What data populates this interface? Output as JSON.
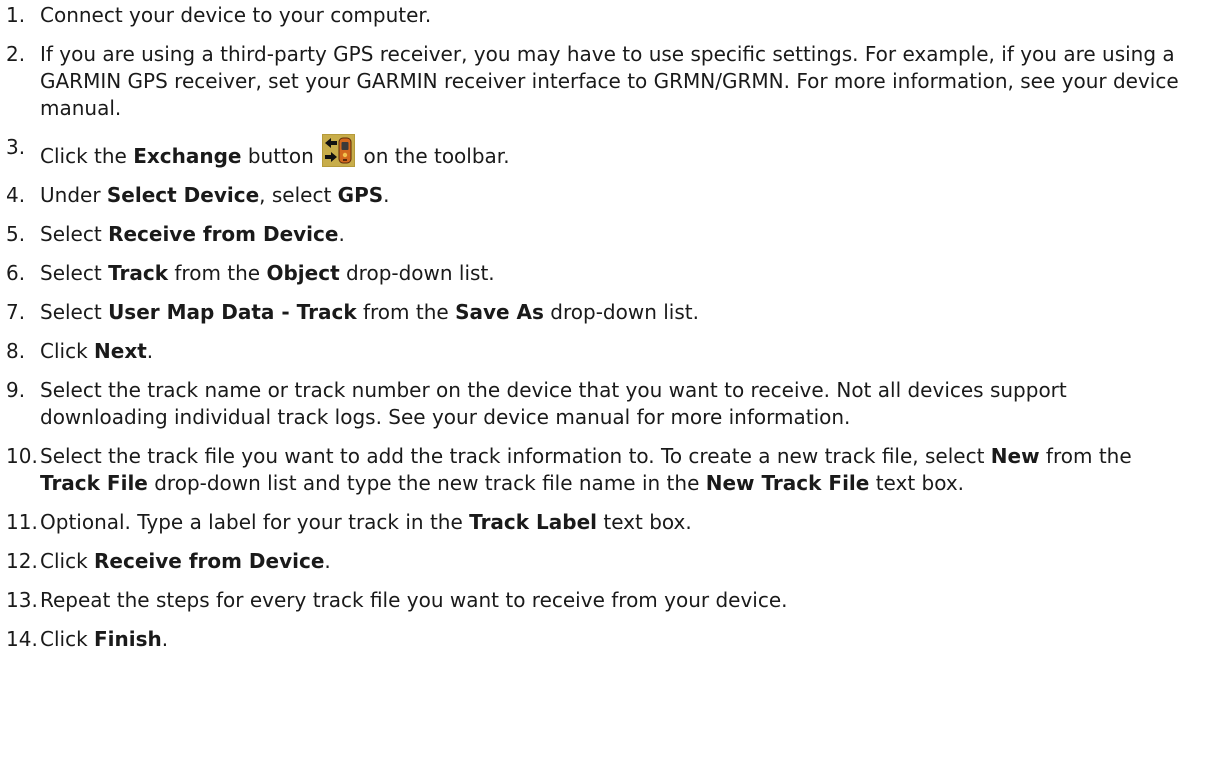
{
  "steps": [
    {
      "num": "1.",
      "segments": [
        {
          "text": "Connect your device to your computer."
        }
      ]
    },
    {
      "num": "2.",
      "segments": [
        {
          "text": "If you are using a third-party GPS receiver, you may have to use specific settings. For example, if you are using a GARMIN GPS receiver, set your GARMIN receiver interface to GRMN/GRMN. For more information, see your device manual."
        }
      ]
    },
    {
      "num": "3.",
      "segments": [
        {
          "text": "Click the "
        },
        {
          "text": "Exchange",
          "bold": true
        },
        {
          "text": " button "
        },
        {
          "icon": "exchange-icon"
        },
        {
          "text": " on the toolbar."
        }
      ]
    },
    {
      "num": "4.",
      "segments": [
        {
          "text": "Under "
        },
        {
          "text": "Select Device",
          "bold": true
        },
        {
          "text": ", select "
        },
        {
          "text": "GPS",
          "bold": true
        },
        {
          "text": "."
        }
      ]
    },
    {
      "num": "5.",
      "segments": [
        {
          "text": "Select "
        },
        {
          "text": "Receive from Device",
          "bold": true
        },
        {
          "text": "."
        }
      ]
    },
    {
      "num": "6.",
      "segments": [
        {
          "text": "Select "
        },
        {
          "text": "Track",
          "bold": true
        },
        {
          "text": " from the "
        },
        {
          "text": "Object",
          "bold": true
        },
        {
          "text": " drop-down list."
        }
      ]
    },
    {
      "num": "7.",
      "segments": [
        {
          "text": "Select "
        },
        {
          "text": "User Map Data - Track",
          "bold": true
        },
        {
          "text": " from the "
        },
        {
          "text": "Save As",
          "bold": true
        },
        {
          "text": " drop-down list."
        }
      ]
    },
    {
      "num": "8.",
      "segments": [
        {
          "text": "Click "
        },
        {
          "text": "Next",
          "bold": true
        },
        {
          "text": "."
        }
      ]
    },
    {
      "num": "9.",
      "segments": [
        {
          "text": "Select the track name or track number on the device that you want to receive. Not all devices support downloading individual track logs. See your device manual for more information."
        }
      ]
    },
    {
      "num": "10.",
      "segments": [
        {
          "text": "Select the track file you want to add the track information to. To create a new track file, select "
        },
        {
          "text": "New",
          "bold": true
        },
        {
          "text": " from the "
        },
        {
          "text": "Track File",
          "bold": true
        },
        {
          "text": " drop-down list and type the new track file name in the "
        },
        {
          "text": "New Track File",
          "bold": true
        },
        {
          "text": " text box."
        }
      ]
    },
    {
      "num": "11.",
      "segments": [
        {
          "text": "Optional. Type a label for your track in the "
        },
        {
          "text": "Track Label",
          "bold": true
        },
        {
          "text": " text box."
        }
      ]
    },
    {
      "num": "12.",
      "segments": [
        {
          "text": "Click "
        },
        {
          "text": "Receive from Device",
          "bold": true
        },
        {
          "text": "."
        }
      ]
    },
    {
      "num": "13.",
      "segments": [
        {
          "text": "Repeat the steps for every track file you want to receive from your device."
        }
      ]
    },
    {
      "num": "14.",
      "segments": [
        {
          "text": "Click "
        },
        {
          "text": "Finish",
          "bold": true
        },
        {
          "text": "."
        }
      ]
    }
  ],
  "colors": {
    "text": "#1a1a1a",
    "icon_background": "#b59a3a",
    "icon_device": "#d2691e"
  }
}
